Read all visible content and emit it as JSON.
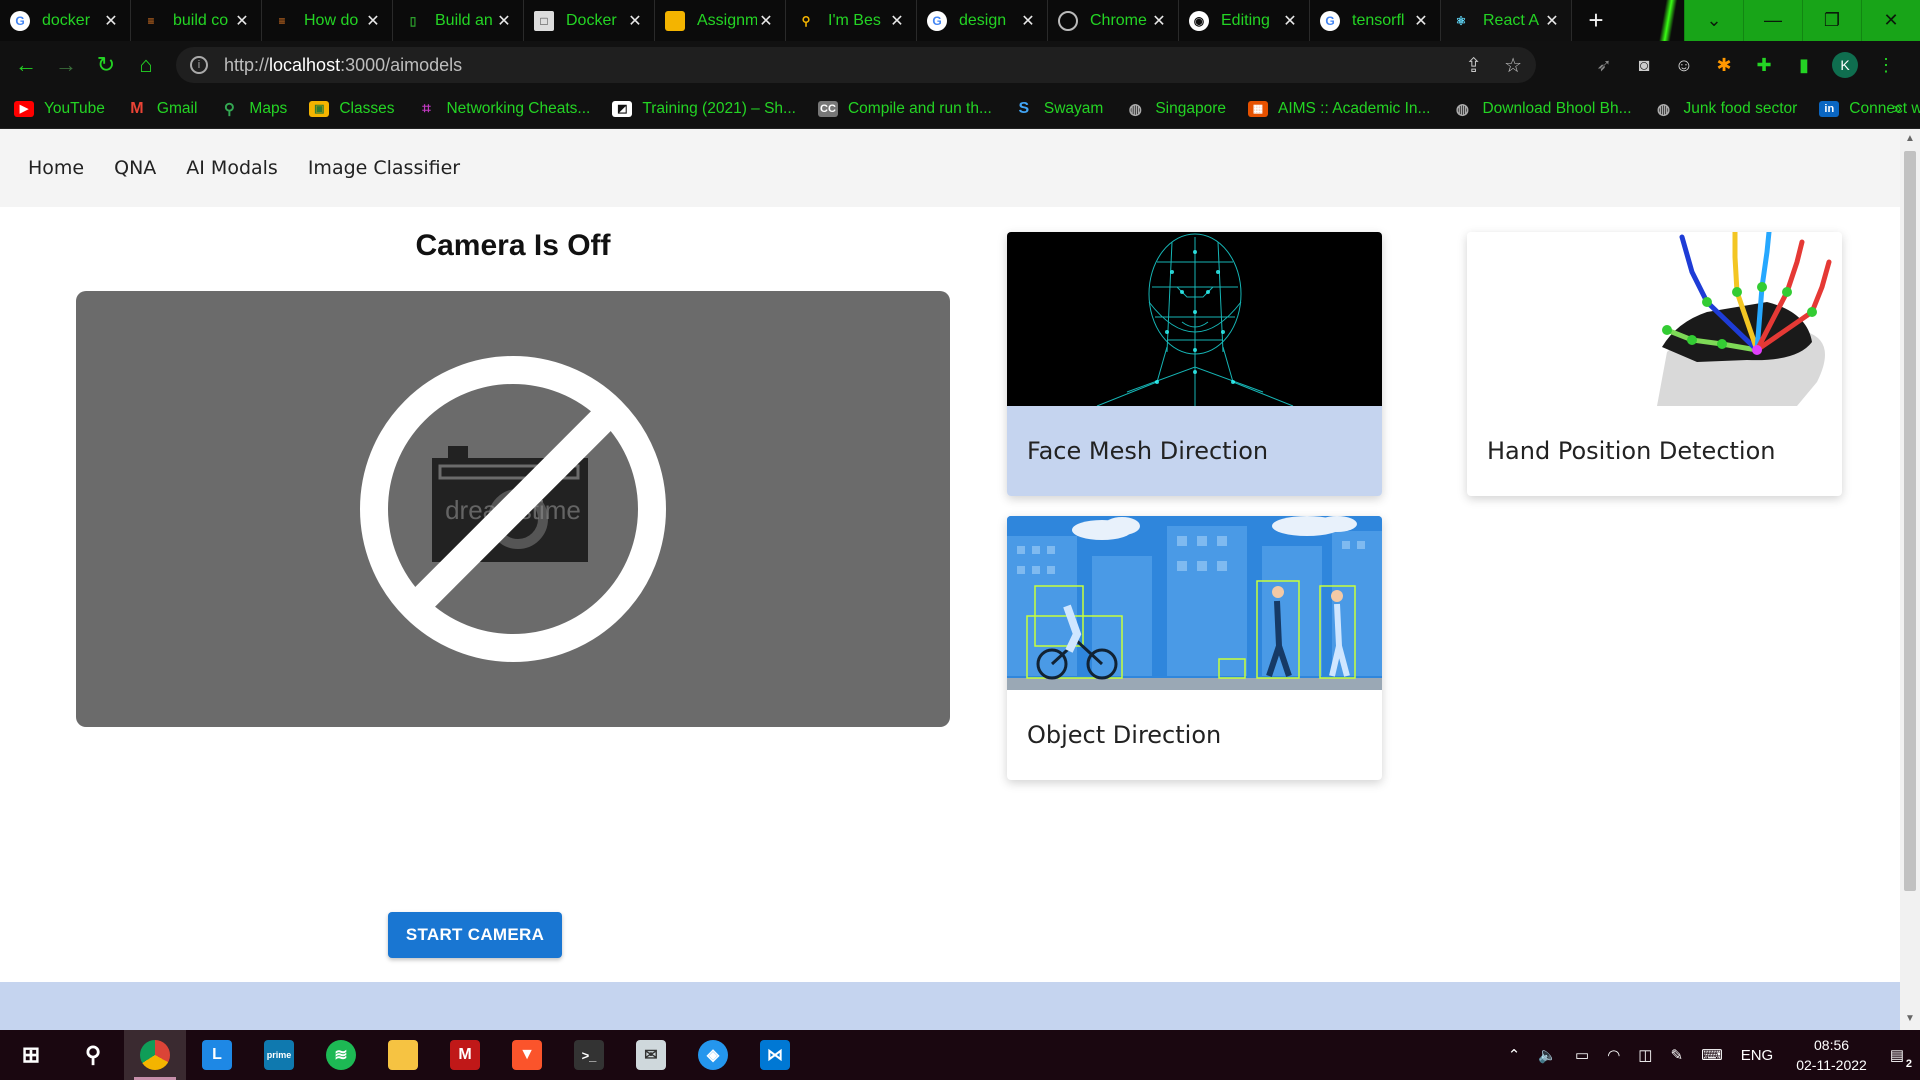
{
  "browser": {
    "tabs": [
      {
        "title": "docker",
        "favicon": "google-icon",
        "color": "#ffffff"
      },
      {
        "title": "build co",
        "favicon": "stackoverflow-icon",
        "color": "#f48024"
      },
      {
        "title": "How do",
        "favicon": "stackoverflow-icon",
        "color": "#f48024"
      },
      {
        "title": "Build an",
        "favicon": "document-icon",
        "color": "#2ca02c"
      },
      {
        "title": "Docker",
        "favicon": "page-icon",
        "color": "#dddddd"
      },
      {
        "title": "Assignm",
        "favicon": "slides-icon",
        "color": "#f4b400"
      },
      {
        "title": "I'm Bes",
        "favicon": "search-icon",
        "color": "#f4b400"
      },
      {
        "title": "design",
        "favicon": "google-icon",
        "color": "#ffffff"
      },
      {
        "title": "Chrome",
        "favicon": "globe-icon",
        "color": "#cccccc"
      },
      {
        "title": "Editing",
        "favicon": "github-icon",
        "color": "#ffffff"
      },
      {
        "title": "tensorfl",
        "favicon": "google-icon",
        "color": "#ffffff"
      },
      {
        "title": "React A",
        "favicon": "react-icon",
        "color": "#61dafb"
      }
    ],
    "url_prefix": "http://",
    "url_host": "localhost",
    "url_path": ":3000/aimodels",
    "profile_initial": "K",
    "bookmarks": [
      {
        "label": "YouTube",
        "color": "#ff0000",
        "icon": "youtube-icon"
      },
      {
        "label": "Gmail",
        "color": "#ea4335",
        "icon": "gmail-icon"
      },
      {
        "label": "Maps",
        "color": "#34a853",
        "icon": "maps-icon"
      },
      {
        "label": "Classes",
        "color": "#f4b400",
        "icon": "classroom-icon"
      },
      {
        "label": "Networking Cheats...",
        "color": "#9c27b0",
        "icon": "network-icon"
      },
      {
        "label": "Training (2021) – Sh...",
        "color": "#ffffff",
        "icon": "training-icon"
      },
      {
        "label": "Compile and run th...",
        "color": "#777777",
        "icon": "cc-icon"
      },
      {
        "label": "Swayam",
        "color": "#1565c0",
        "icon": "swayam-icon"
      },
      {
        "label": "Singapore",
        "color": "#888888",
        "icon": "globe-icon"
      },
      {
        "label": "AIMS :: Academic In...",
        "color": "#e65100",
        "icon": "aims-icon"
      },
      {
        "label": "Download Bhool Bh...",
        "color": "#888888",
        "icon": "globe-icon"
      },
      {
        "label": "Junk food sector",
        "color": "#888888",
        "icon": "globe-icon"
      },
      {
        "label": "Connect with",
        "color": "#0a66c2",
        "icon": "linkedin-icon"
      }
    ]
  },
  "nav": {
    "items": [
      "Home",
      "QNA",
      "AI Modals",
      "Image Classifier"
    ]
  },
  "camera": {
    "title": "Camera Is Off",
    "button_label": "START CAMERA",
    "watermark": "dreamstime"
  },
  "cards": [
    {
      "label": "Face Mesh Direction"
    },
    {
      "label": "Hand Position Detection"
    },
    {
      "label": "Object Direction"
    }
  ],
  "taskbar": {
    "language": "ENG",
    "time": "08:56",
    "date": "02-11-2022",
    "notification_count": "2"
  },
  "colors": {
    "accent": "#1976d2",
    "card_highlight": "#c5d4ef",
    "chrome_text": "#24d424"
  }
}
